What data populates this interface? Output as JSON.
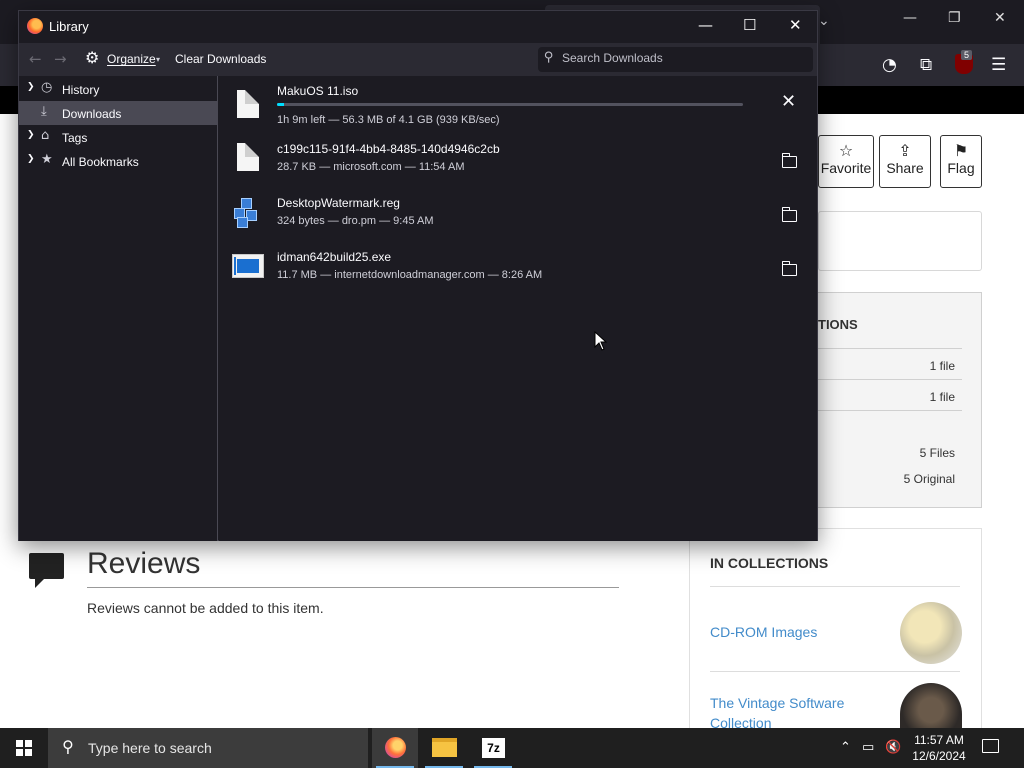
{
  "library": {
    "title": "Library",
    "toolbar": {
      "organize_label": "Organize",
      "clear_downloads_label": "Clear Downloads",
      "search_placeholder": "Search Downloads"
    },
    "sidebar": {
      "items": [
        {
          "label": "History",
          "icon": "clock-icon",
          "expandable": true,
          "selected": false
        },
        {
          "label": "Downloads",
          "icon": "download-icon",
          "expandable": false,
          "selected": true
        },
        {
          "label": "Tags",
          "icon": "tag-icon",
          "expandable": true,
          "selected": false
        },
        {
          "label": "All Bookmarks",
          "icon": "star-icon",
          "expandable": true,
          "selected": false
        }
      ]
    },
    "downloads": [
      {
        "name": "MakuOS 11.iso",
        "status": "1h 9m left — 56.3 MB of 4.1 GB (939 KB/sec)",
        "progress": 0.014,
        "state": "downloading",
        "icon": "file-icon"
      },
      {
        "name": "c199c115-91f4-4bb4-8485-140d4946c2cb",
        "status": "28.7 KB — microsoft.com — 11:54 AM",
        "state": "complete",
        "icon": "file-icon"
      },
      {
        "name": "DesktopWatermark.reg",
        "status": "324 bytes — dro.pm — 9:45 AM",
        "state": "complete",
        "icon": "registry-file-icon"
      },
      {
        "name": "idman642build25.exe",
        "status": "11.7 MB — internetdownloadmanager.com — 8:26 AM",
        "state": "complete",
        "icon": "exe-file-icon"
      }
    ]
  },
  "background_page": {
    "actions": {
      "favorite": "Favorite",
      "share": "Share",
      "flag": "Flag"
    },
    "operations_title": "TIONS",
    "operations_rows": [
      "1 file",
      "1 file",
      "5 Files",
      "5 Original"
    ],
    "extension_badge": "5",
    "reviews": {
      "title": "Reviews",
      "text": "Reviews cannot be added to this item."
    },
    "collections": {
      "title": "IN COLLECTIONS",
      "items": [
        "CD-ROM Images",
        "The Vintage Software Collection"
      ]
    }
  },
  "taskbar": {
    "search_placeholder": "Type here to search",
    "apps": [
      "firefox",
      "file-explorer",
      "7-zip"
    ],
    "sevenzip_label": "7z",
    "time": "11:57 AM",
    "date": "12/6/2024"
  },
  "colors": {
    "accent_progress": "#00ddff",
    "window_bg": "#1c1b22",
    "toolbar_bg": "#2b2a33",
    "link": "#428bca"
  }
}
